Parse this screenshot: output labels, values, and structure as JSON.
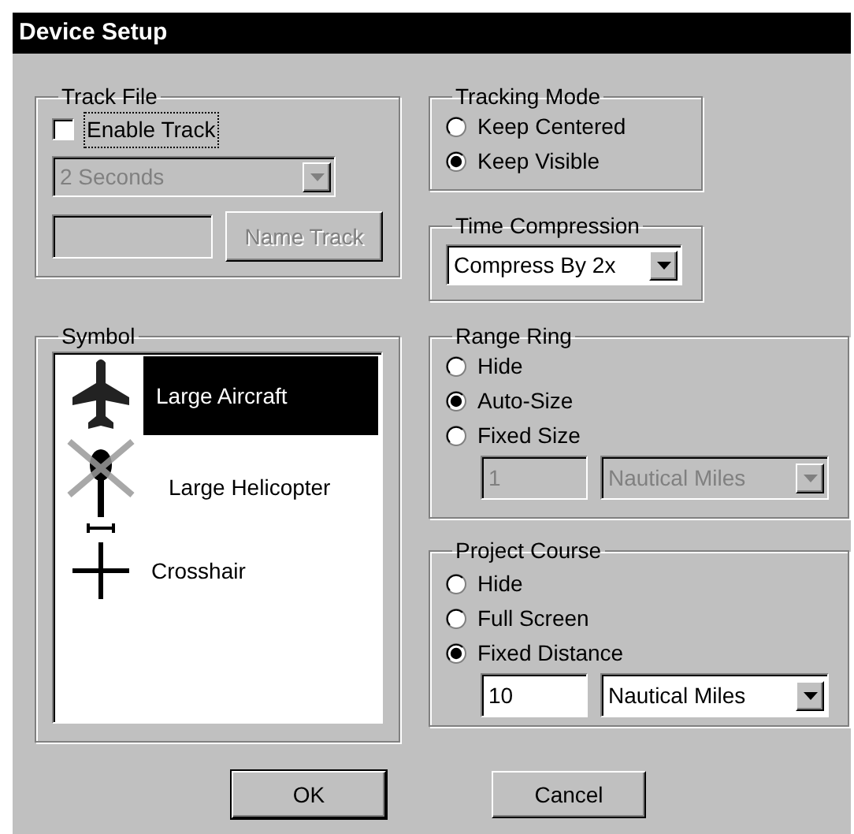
{
  "window": {
    "title": "Device Setup"
  },
  "track_file": {
    "title": "Track File",
    "enable_track": {
      "label": "Enable Track",
      "checked": false,
      "focused": true
    },
    "interval": {
      "value": "2 Seconds",
      "disabled": true
    },
    "name_field": {
      "disabled": true
    },
    "name_button": {
      "label": "Name Track",
      "disabled": true
    }
  },
  "symbol": {
    "title": "Symbol",
    "items": [
      {
        "label": "Large Aircraft",
        "kind": "aircraft",
        "selected": true
      },
      {
        "label": "Large Helicopter",
        "kind": "helicopter",
        "selected": false
      },
      {
        "label": "Crosshair",
        "kind": "crosshair",
        "selected": false
      }
    ]
  },
  "tracking_mode": {
    "title": "Tracking Mode",
    "options": [
      {
        "label": "Keep Centered",
        "selected": false
      },
      {
        "label": "Keep Visible",
        "selected": true
      }
    ]
  },
  "time_compression": {
    "title": "Time Compression",
    "value": "Compress By 2x",
    "disabled": false
  },
  "range_ring": {
    "title": "Range Ring",
    "options": [
      {
        "label": "Hide",
        "selected": false
      },
      {
        "label": "Auto-Size",
        "selected": true
      },
      {
        "label": "Fixed Size",
        "selected": false
      }
    ],
    "size": {
      "value": "1",
      "disabled": true
    },
    "units": {
      "value": "Nautical Miles",
      "disabled": true
    }
  },
  "project_course": {
    "title": "Project Course",
    "options": [
      {
        "label": "Hide",
        "selected": false
      },
      {
        "label": "Full Screen",
        "selected": false
      },
      {
        "label": "Fixed Distance",
        "selected": true
      }
    ],
    "distance": {
      "value": "10",
      "disabled": false
    },
    "units": {
      "value": "Nautical Miles",
      "disabled": false
    }
  },
  "buttons": [
    {
      "label": "OK",
      "default": true
    },
    {
      "label": "Cancel",
      "default": false
    }
  ]
}
